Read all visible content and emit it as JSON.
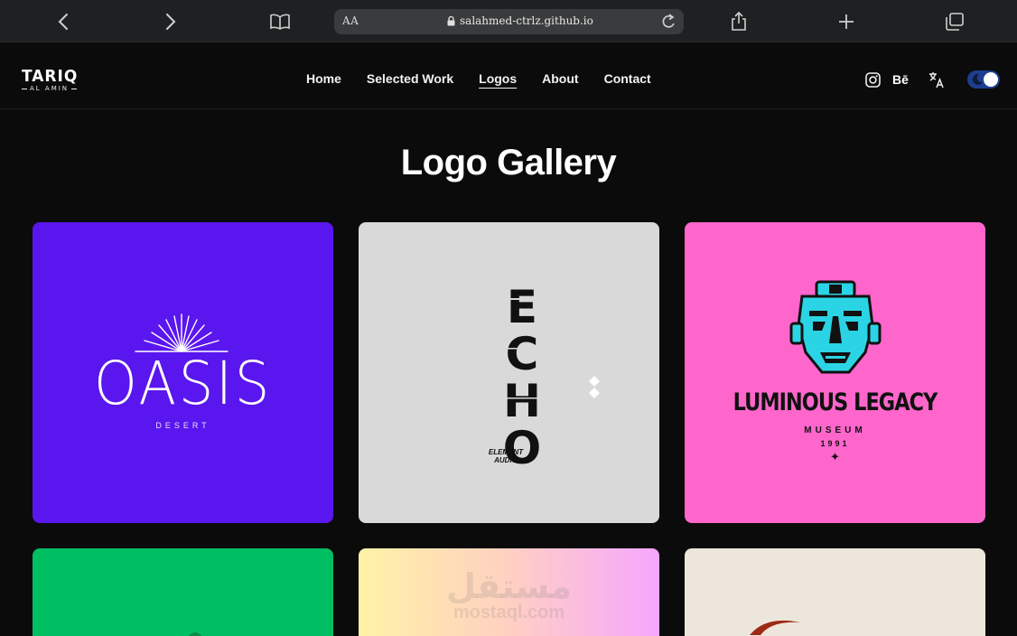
{
  "browser": {
    "text_size_label": "AA",
    "url": "salahmed-ctrlz.github.io"
  },
  "site": {
    "logo_main": "TARIQ",
    "logo_sub": "AL AMIN",
    "nav": [
      "Home",
      "Selected Work",
      "Logos",
      "About",
      "Contact"
    ],
    "active_nav": "Logos",
    "social": [
      "instagram-icon",
      "behance-icon",
      "translate-icon"
    ],
    "behance_label": "Bē",
    "theme_toggle": "dark-mode"
  },
  "gallery": {
    "title": "Logo Gallery",
    "cards": [
      {
        "bg": "#5a16ee",
        "name": "OASIS",
        "sub": "DESERT"
      },
      {
        "bg": "#d9d9d9",
        "name": "ECHO",
        "sub_line1": "ELEMENT",
        "sub_line2": "AUDIO"
      },
      {
        "bg": "#ff66cc",
        "name": "LUMINOUS LEGACY",
        "sub": "MUSEUM",
        "year": "1991",
        "star": "✦"
      },
      {
        "bg": "#00bf63"
      },
      {
        "bg": "gradient"
      },
      {
        "bg": "#ece6dc"
      }
    ]
  },
  "watermark": {
    "arabic": "مستقل",
    "latin": "mostaql.com"
  }
}
